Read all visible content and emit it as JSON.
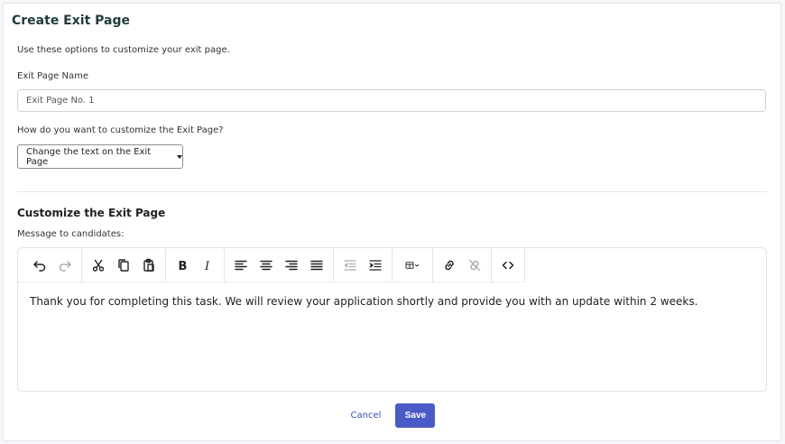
{
  "page": {
    "title": "Create Exit Page",
    "description": "Use these options to customize your exit page."
  },
  "exit_page_name": {
    "label": "Exit Page Name",
    "value": "Exit Page No. 1"
  },
  "customize_select": {
    "label": "How do you want to customize the Exit Page?",
    "selected": "Change the text on the Exit Page"
  },
  "customize_section": {
    "title": "Customize the Exit Page",
    "message_label": "Message to candidates:"
  },
  "editor": {
    "toolbar_icons": [
      "undo-icon",
      "redo-icon",
      "cut-icon",
      "copy-icon",
      "paste-icon",
      "bold-icon",
      "italic-icon",
      "align-left-icon",
      "align-center-icon",
      "align-right-icon",
      "align-justify-icon",
      "outdent-icon",
      "indent-icon",
      "table-icon",
      "link-icon",
      "unlink-icon",
      "source-code-icon"
    ],
    "content": "Thank you for completing this task. We will review your application shortly and provide you with an update within 2 weeks."
  },
  "actions": {
    "cancel_label": "Cancel",
    "save_label": "Save"
  },
  "colors": {
    "accent": "#4a5bc7",
    "link": "#3b4fb0",
    "title": "#1f3a3d"
  }
}
